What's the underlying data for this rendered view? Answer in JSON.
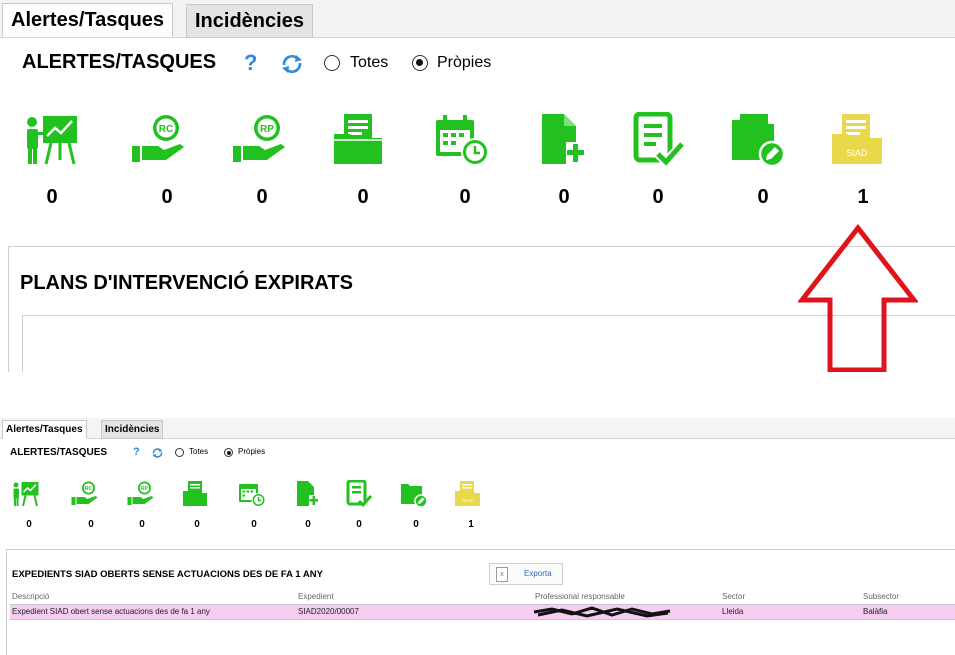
{
  "tabs": {
    "alerts": "Alertes/Tasques",
    "incidents": "Incidències"
  },
  "header": {
    "title": "ALERTES/TASQUES",
    "help": "?"
  },
  "filters": {
    "all": "Totes",
    "own": "Pròpies",
    "selected": "Pròpies"
  },
  "icons": [
    {
      "name": "presentation-icon",
      "count": "0",
      "color": "#22c11f"
    },
    {
      "name": "rc-hand-icon",
      "count": "0",
      "color": "#22c11f"
    },
    {
      "name": "rp-hand-icon",
      "count": "0",
      "color": "#22c11f"
    },
    {
      "name": "folder-document-icon",
      "count": "0",
      "color": "#22c11f"
    },
    {
      "name": "calendar-clock-icon",
      "count": "0",
      "color": "#22c11f"
    },
    {
      "name": "file-add-icon",
      "count": "0",
      "color": "#22c11f"
    },
    {
      "name": "checklist-icon",
      "count": "0",
      "color": "#22c11f"
    },
    {
      "name": "folder-edit-icon",
      "count": "0",
      "color": "#22c11f"
    },
    {
      "name": "siad-folder-icon",
      "count": "1",
      "color": "#e8d84a",
      "label": "SIAD"
    }
  ],
  "big_panel": {
    "title": "PLANS D'INTERVENCIÓ EXPIRATS"
  },
  "small_panel": {
    "title": "EXPEDIENTS SIAD  OBERTS SENSE ACTUACIONS DES DE FA 1 ANY",
    "export_label": "Exporta",
    "columns": [
      "Descripció",
      "Expedient",
      "Professional responsable",
      "Sector",
      "Subsector"
    ],
    "rows": [
      {
        "descripcio": "Expedient SIAD obert sense actuacions des de fa 1 any",
        "expedient": "SIAD2020/00007",
        "sector": "Lleida",
        "subsector": "Balàfia"
      }
    ]
  },
  "colors": {
    "green": "#22c11f",
    "yellow": "#e8d84a",
    "accent_blue": "#2a8de0",
    "arrow_red": "#e0121b",
    "row_highlight": "#f6cdf1"
  }
}
